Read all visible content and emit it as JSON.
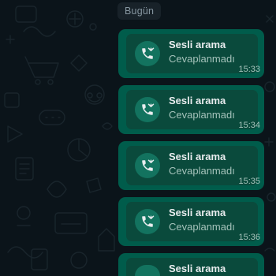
{
  "chat": {
    "date_chip": "Bugün",
    "messages": [
      {
        "title": "Sesli arama",
        "status": "Cevaplanmadı",
        "time": "15:33",
        "icon": "missed-voice-call-icon"
      },
      {
        "title": "Sesli arama",
        "status": "Cevaplanmadı",
        "time": "15:34",
        "icon": "missed-voice-call-icon"
      },
      {
        "title": "Sesli arama",
        "status": "Cevaplanmadı",
        "time": "15:35",
        "icon": "missed-voice-call-icon"
      },
      {
        "title": "Sesli arama",
        "status": "Cevaplanmadı",
        "time": "15:36",
        "icon": "missed-voice-call-icon"
      },
      {
        "title": "Sesli arama",
        "status": "",
        "time": "",
        "icon": "missed-voice-call-icon"
      }
    ]
  },
  "colors": {
    "background": "#0b141a",
    "bubble_outgoing": "#005c4b",
    "bubble_inner": "#0a4a3c",
    "text_primary": "#e9edef",
    "text_secondary": "#a4c2ba"
  }
}
